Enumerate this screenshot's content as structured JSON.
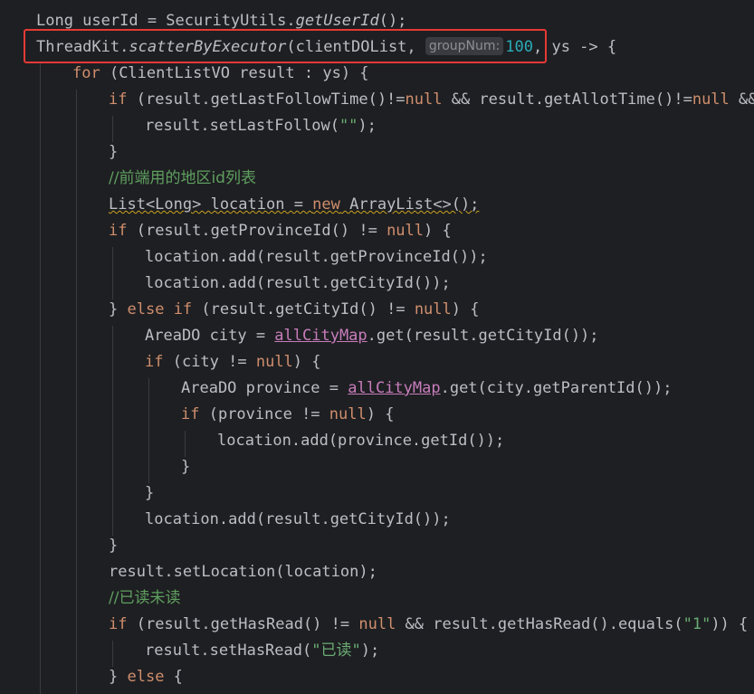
{
  "editor": {
    "line1": {
      "a": "Long userId = SecurityUtils.",
      "b": "getUserId",
      "c": "();"
    },
    "line2": {
      "a": "ThreadKit.",
      "b": "scatterByExecutor",
      "c": "(clientDOList, ",
      "hint": "groupNum:",
      "num": "100",
      "d": ", ys -> {"
    },
    "line3": {
      "kw": "for",
      "a": " (ClientListVO result : ys) {"
    },
    "line4": {
      "kw": "if",
      "a": " (result.getLastFollowTime()!=",
      "null1": "null",
      "b": " && result.getAllotTime()!=",
      "null2": "null",
      "c": " && r"
    },
    "line5": {
      "a": "result.setLastFollow(",
      "str": "\"\"",
      "b": ");"
    },
    "line6": {
      "a": "}"
    },
    "line7": {
      "cmt": "//前端用的地区id列表"
    },
    "line8": {
      "a": "List<Long> location = ",
      "kw": "new",
      "b": " ArrayList<>();"
    },
    "line9": {
      "kw": "if",
      "a": " (result.getProvinceId() != ",
      "null": "null",
      "b": ") {"
    },
    "line10": {
      "a": "location.add(result.getProvinceId());"
    },
    "line11": {
      "a": "location.add(result.getCityId());"
    },
    "line12": {
      "a": "} ",
      "kw1": "else",
      "sp": " ",
      "kw2": "if",
      "b": " (result.getCityId() != ",
      "null": "null",
      "c": ") {"
    },
    "line13": {
      "a": "AreaDO city = ",
      "field": "allCityMap",
      "b": ".get(result.getCityId());"
    },
    "line14": {
      "kw": "if",
      "a": " (city != ",
      "null": "null",
      "b": ") {"
    },
    "line15": {
      "a": "AreaDO province = ",
      "field": "allCityMap",
      "b": ".get(city.getParentId());"
    },
    "line16": {
      "kw": "if",
      "a": " (province != ",
      "null": "null",
      "b": ") {"
    },
    "line17": {
      "a": "location.add(province.getId());"
    },
    "line18": {
      "a": "}"
    },
    "line19": {
      "a": "}"
    },
    "line20": {
      "a": "location.add(result.getCityId());"
    },
    "line21": {
      "a": "}"
    },
    "line22": {
      "a": "result.setLocation(location);"
    },
    "line23": {
      "cmt": "//已读未读"
    },
    "line24": {
      "kw": "if",
      "a": " (result.getHasRead() != ",
      "null": "null",
      "b": " && result.getHasRead().equals(",
      "str": "\"1\"",
      "c": ")) {"
    },
    "line25": {
      "a": "result.setHasRead(",
      "str": "\"已读\"",
      "b": ");"
    },
    "line26": {
      "a": "} ",
      "kw": "else",
      "b": " {"
    }
  },
  "colors": {
    "background": "#1e1f22",
    "keyword": "#cf8e6d",
    "string": "#6aab73",
    "number": "#2aacb8",
    "field": "#c77dbb",
    "highlight_box": "#e53935"
  }
}
